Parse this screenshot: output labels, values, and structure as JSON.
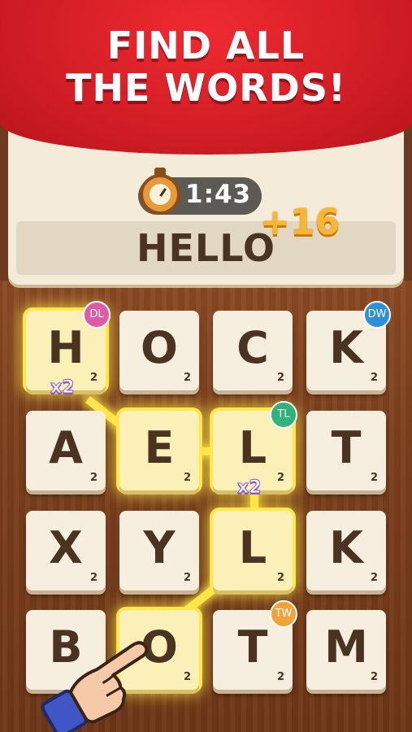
{
  "header": {
    "title_line1": "FIND ALL",
    "title_line2": "THE WORDS!"
  },
  "timer": {
    "value": "1:43"
  },
  "current_word": "HELLO",
  "score_popup": "+16",
  "grid": [
    [
      {
        "letter": "H",
        "points": "2",
        "badge": "DL",
        "multiplier": "x2"
      },
      {
        "letter": "O",
        "points": "2"
      },
      {
        "letter": "C",
        "points": "2"
      },
      {
        "letter": "K",
        "points": "2",
        "badge": "DW"
      }
    ],
    [
      {
        "letter": "A",
        "points": "2"
      },
      {
        "letter": "E",
        "points": "2"
      },
      {
        "letter": "L",
        "points": "2",
        "badge": "TL",
        "multiplier": "x2"
      },
      {
        "letter": "T",
        "points": "2"
      }
    ],
    [
      {
        "letter": "X",
        "points": "2"
      },
      {
        "letter": "Y",
        "points": "2"
      },
      {
        "letter": "L",
        "points": "2"
      },
      {
        "letter": "K",
        "points": "2"
      }
    ],
    [
      {
        "letter": "B",
        "points": "2"
      },
      {
        "letter": "O",
        "points": "2"
      },
      {
        "letter": "T",
        "points": "2",
        "badge": "TW"
      },
      {
        "letter": "M",
        "points": "2"
      }
    ]
  ],
  "colors": {
    "DL": "#e05aa6",
    "DW": "#2f8fd8",
    "TL": "#2fb37a",
    "TW": "#f0a33a",
    "banner": "#d11d25"
  },
  "icons": {
    "timer": "stopwatch-icon",
    "pointer": "pointing-hand-icon"
  }
}
